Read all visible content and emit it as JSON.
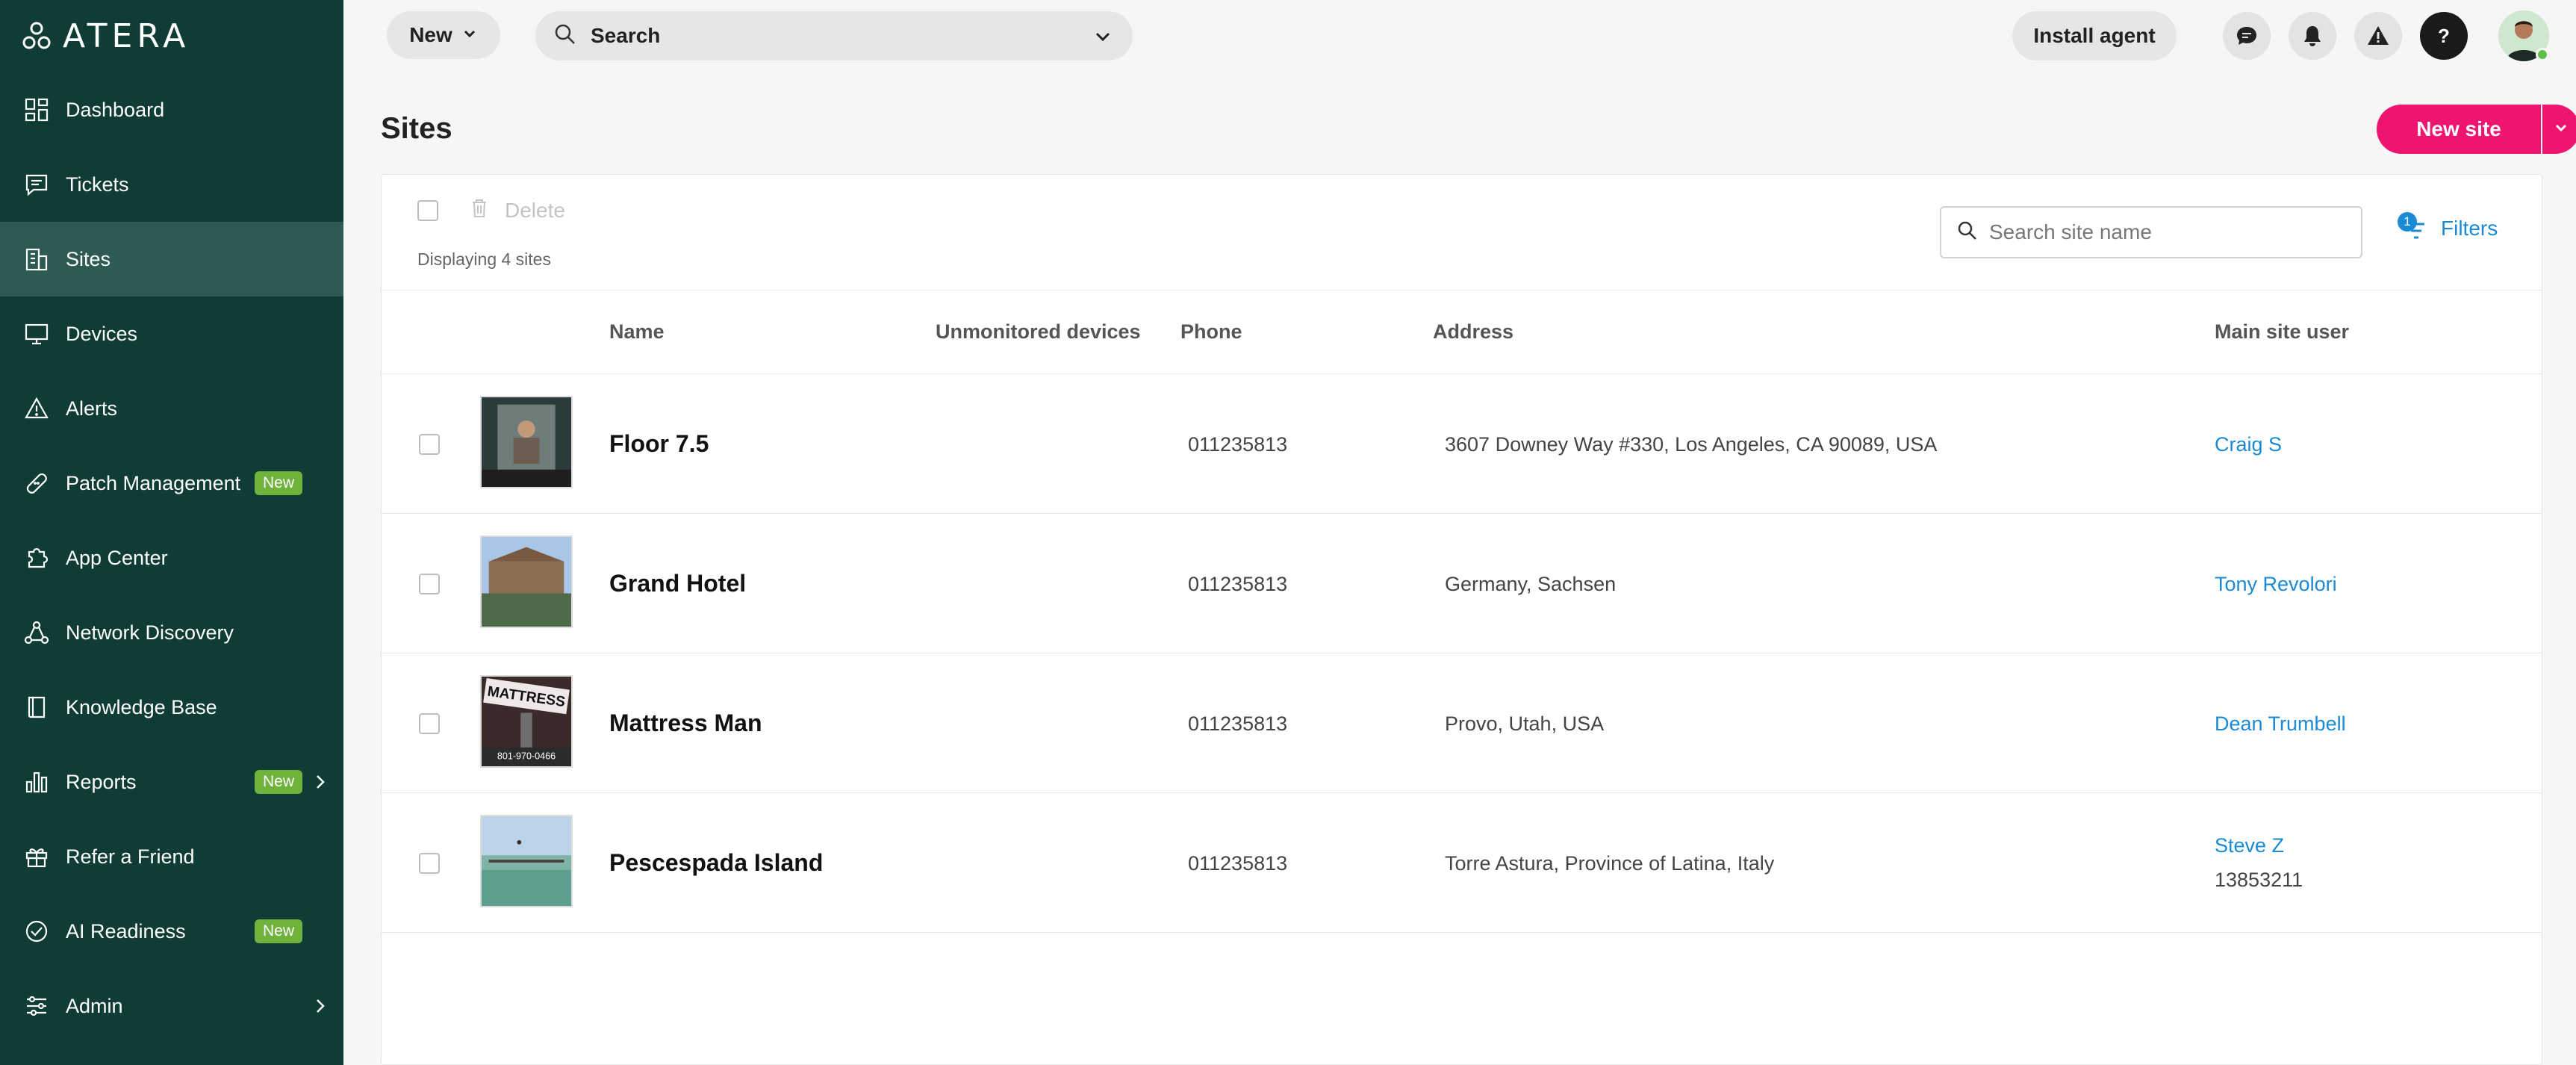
{
  "brand": {
    "logo_text": "ATERA"
  },
  "sidebar": {
    "items": [
      {
        "label": "Dashboard",
        "icon": "dashboard-icon"
      },
      {
        "label": "Tickets",
        "icon": "ticket-icon"
      },
      {
        "label": "Sites",
        "icon": "building-icon",
        "active": true
      },
      {
        "label": "Devices",
        "icon": "monitor-icon"
      },
      {
        "label": "Alerts",
        "icon": "alert-icon"
      },
      {
        "label": "Patch Management",
        "icon": "bandage-icon",
        "badge": "New"
      },
      {
        "label": "App Center",
        "icon": "puzzle-icon"
      },
      {
        "label": "Network Discovery",
        "icon": "network-icon"
      },
      {
        "label": "Knowledge Base",
        "icon": "book-icon"
      },
      {
        "label": "Reports",
        "icon": "bar-chart-icon",
        "badge": "New",
        "chevron": true
      },
      {
        "label": "Refer a Friend",
        "icon": "gift-icon"
      },
      {
        "label": "AI Readiness",
        "icon": "check-circle-icon",
        "badge": "New"
      },
      {
        "label": "Admin",
        "icon": "sliders-icon",
        "chevron": true
      }
    ]
  },
  "topbar": {
    "new_label": "New",
    "search_label": "Search",
    "install_label": "Install agent"
  },
  "page": {
    "title": "Sites",
    "new_site_label": "New site"
  },
  "toolbar": {
    "delete_label": "Delete",
    "count_text": "Displaying 4 sites",
    "search_placeholder": "Search site name",
    "filters_label": "Filters",
    "filters_count": "1"
  },
  "table": {
    "headers": {
      "name": "Name",
      "unmonitored": "Unmonitored devices",
      "phone": "Phone",
      "address": "Address",
      "main_user": "Main site user"
    },
    "rows": [
      {
        "name": "Floor 7.5",
        "phone": "011235813",
        "address": "3607 Downey Way #330, Los Angeles, CA 90089, USA",
        "user": "Craig S",
        "user_id": ""
      },
      {
        "name": "Grand Hotel",
        "phone": "011235813",
        "address": "Germany, Sachsen",
        "user": "Tony Revolori",
        "user_id": ""
      },
      {
        "name": "Mattress Man",
        "phone": "011235813",
        "address": "Provo, Utah, USA",
        "user": "Dean Trumbell",
        "user_id": ""
      },
      {
        "name": "Pescespada Island",
        "phone": "011235813",
        "address": "Torre Astura, Province of Latina, Italy",
        "user": "Steve Z",
        "user_id": "13853211"
      }
    ]
  },
  "thumbs": {
    "row0": {
      "top": "#2b3a3a",
      "mid": "#6b5d4f",
      "bottom": "#1f1f1f"
    },
    "row1": {
      "top": "#a9c6e6",
      "mid": "#8a6f52",
      "bottom": "#4f6a4a"
    },
    "row2": {
      "top": "#3b2a2a",
      "mid": "#6e6e6e",
      "bottom": "#2b2b2b"
    },
    "row3": {
      "top": "#bcd3e8",
      "mid": "#7fb3a8",
      "bottom": "#5da090"
    }
  },
  "thumb_texts": {
    "row2": [
      "MATTRESS",
      "801-970-0466"
    ]
  },
  "colors": {
    "sidebar_bg": "#0f3d36",
    "accent": "#ee1570",
    "link": "#1a8ad4",
    "badge": "#6fb23c"
  }
}
